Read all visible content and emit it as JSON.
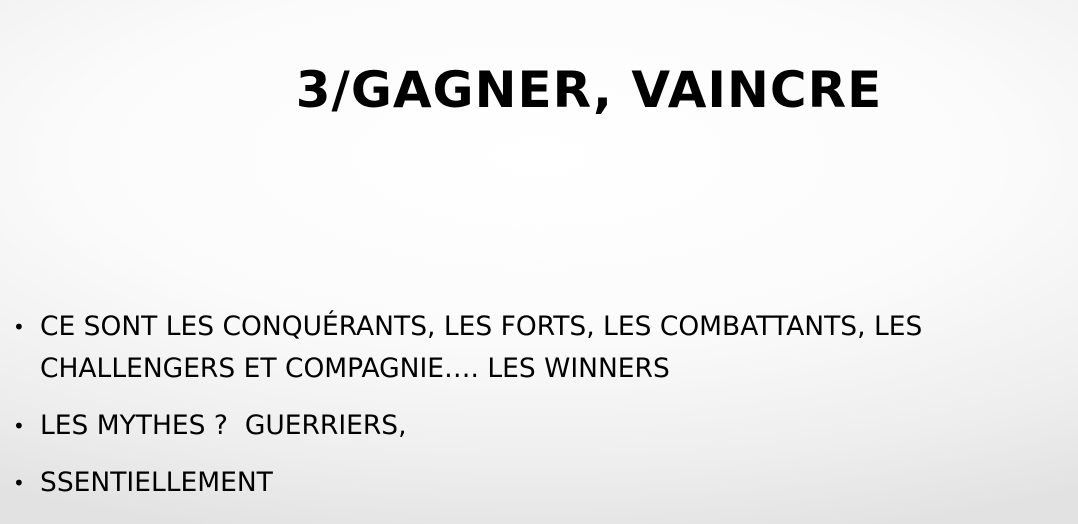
{
  "slide": {
    "title": "3/GAGNER, VAINCRE",
    "bullets": [
      {
        "marker": "•",
        "text": "CE SONT LES CONQUÉRANTS, LES FORTS, LES COMBATTANTS, LES CHALLENGERS ET COMPAGNIE…. LES WINNERS"
      },
      {
        "marker": "•",
        "text": "LES MYTHES ?  GUERRIERS,"
      },
      {
        "marker": "•",
        "text": "SSENTIELLEMENT"
      }
    ]
  }
}
